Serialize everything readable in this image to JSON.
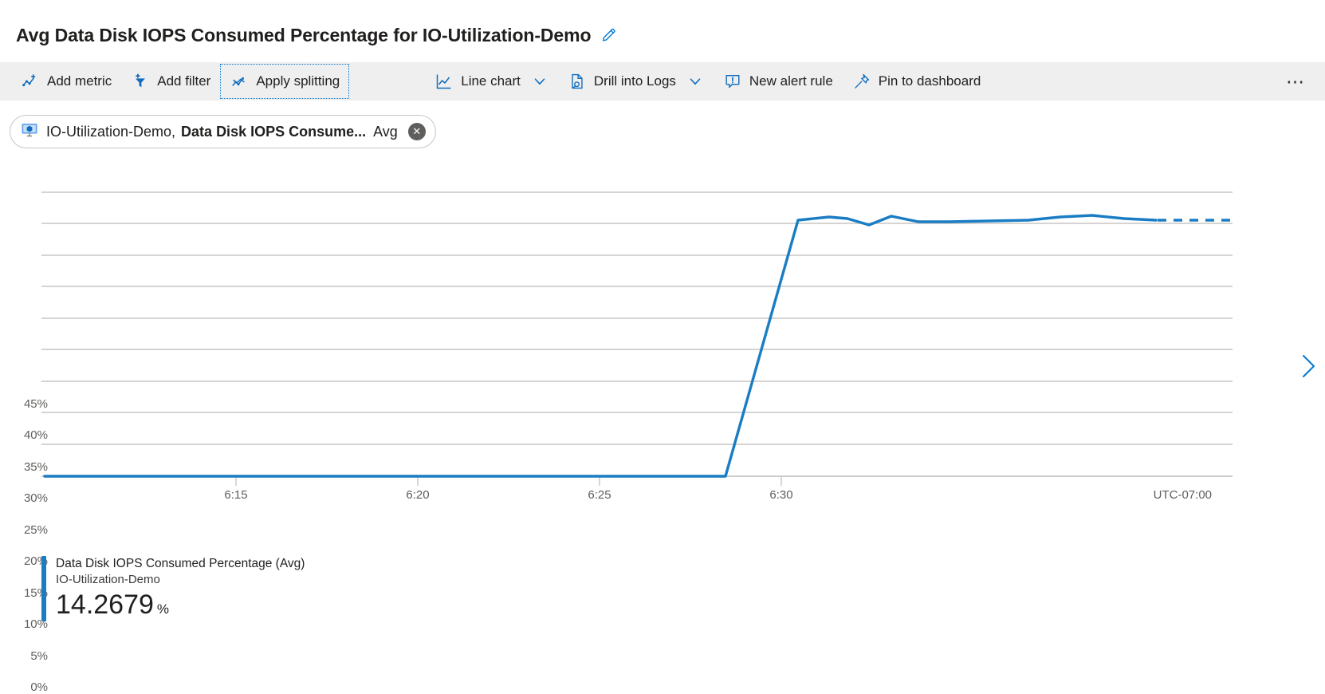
{
  "page": {
    "title": "Avg Data Disk IOPS Consumed Percentage for IO-Utilization-Demo",
    "edit_icon": "pencil-icon"
  },
  "toolbar": {
    "items": [
      {
        "label": "Add metric",
        "icon": "add-metric-icon",
        "chevron": false,
        "focused": false
      },
      {
        "label": "Add filter",
        "icon": "add-filter-icon",
        "chevron": false,
        "focused": false
      },
      {
        "label": "Apply splitting",
        "icon": "apply-splitting-icon",
        "chevron": false,
        "focused": true
      },
      {
        "label": "Line chart",
        "icon": "line-chart-icon",
        "chevron": true,
        "focused": false
      },
      {
        "label": "Drill into Logs",
        "icon": "drill-logs-icon",
        "chevron": true,
        "focused": false
      },
      {
        "label": "New alert rule",
        "icon": "alert-rule-icon",
        "chevron": false,
        "focused": false
      },
      {
        "label": "Pin to dashboard",
        "icon": "pin-icon",
        "chevron": false,
        "focused": false
      }
    ],
    "overflow_label": "⋯"
  },
  "metric_chip": {
    "resource": "IO-Utilization-Demo,",
    "metric": "Data Disk IOPS Consume...",
    "aggregation": "Avg",
    "close_label": "✕",
    "icon": "virtual-machine-icon"
  },
  "legend": {
    "metric": "Data Disk IOPS Consumed Percentage (Avg)",
    "resource": "IO-Utilization-Demo",
    "value": "14.2679",
    "unit": "%"
  },
  "colors": {
    "series": "#1a7dc4",
    "accent": "#0078d4",
    "grid": "#c8c6c4",
    "toolbar_bg": "#efefef",
    "tick_text": "#605e5c"
  },
  "chart_data": {
    "type": "line",
    "title": "Avg Data Disk IOPS Consumed Percentage for IO-Utilization-Demo",
    "xlabel": "",
    "ylabel": "",
    "ylim": [
      0,
      45
    ],
    "grid": true,
    "legend_position": "bottom-left",
    "timezone_label": "UTC-07:00",
    "ytick_labels": [
      "45%",
      "40%",
      "35%",
      "30%",
      "25%",
      "20%",
      "15%",
      "10%",
      "5%",
      "0%"
    ],
    "ytick_values": [
      45,
      40,
      35,
      30,
      25,
      20,
      15,
      10,
      5,
      0
    ],
    "xtick_labels": [
      "6:15",
      "6:20",
      "6:25",
      "6:30"
    ],
    "xtick_values": [
      6.25,
      6.3333,
      6.4167,
      6.5
    ],
    "xlim_labels": [
      "6:11",
      "6:36"
    ],
    "series": [
      {
        "name": "Data Disk IOPS Consumed Percentage (Avg)",
        "resource": "IO-Utilization-Demo",
        "color": "#1a7dc4",
        "current_value": 14.2679,
        "points": [
          {
            "t": "6:11",
            "v": 0
          },
          {
            "t": "6:13",
            "v": 0
          },
          {
            "t": "6:15",
            "v": 0
          },
          {
            "t": "6:17",
            "v": 0
          },
          {
            "t": "6:19",
            "v": 0
          },
          {
            "t": "6:21",
            "v": 0
          },
          {
            "t": "6:23",
            "v": 0
          },
          {
            "t": "6:25",
            "v": 0
          },
          {
            "t": "6:27",
            "v": 0
          },
          {
            "t": "6:28",
            "v": 0
          },
          {
            "t": "6:30",
            "v": 40.5
          },
          {
            "t": "6:31",
            "v": 40.7
          },
          {
            "t": "6:32",
            "v": 40.2
          },
          {
            "t": "6:33",
            "v": 40.8
          },
          {
            "t": "6:34",
            "v": 40.3
          },
          {
            "t": "6:35",
            "v": 40.3
          },
          {
            "t": "6:36",
            "v": 40.4
          },
          {
            "t": "6:37",
            "v": 40.5
          },
          {
            "t": "6:38",
            "v": 40.8
          },
          {
            "t": "6:39",
            "v": 40.4
          }
        ],
        "dashed_tail": {
          "from": "6:39",
          "to": "6:41",
          "value": 40.4
        }
      }
    ]
  }
}
